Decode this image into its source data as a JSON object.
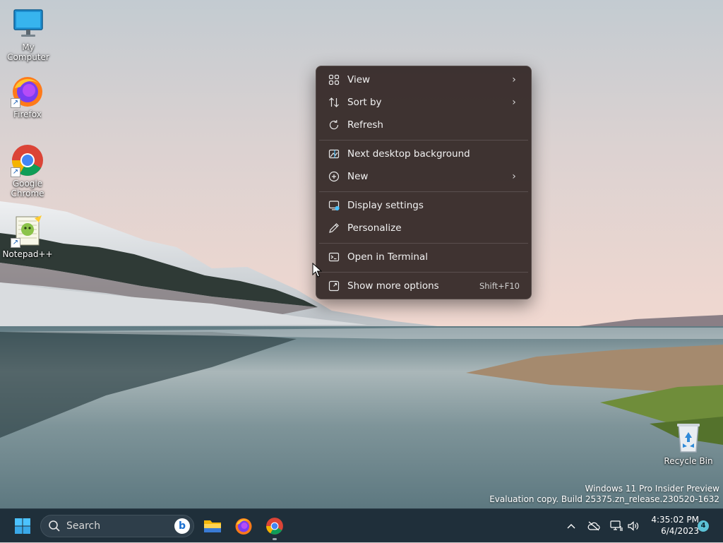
{
  "desktop": {
    "icons": [
      {
        "label": "My Computer",
        "icon": "monitor-icon"
      },
      {
        "label": "Firefox",
        "icon": "firefox-icon"
      },
      {
        "label": "Google Chrome",
        "icon": "chrome-icon"
      },
      {
        "label": "Notepad++",
        "icon": "notepad-plus-plus-icon"
      },
      {
        "label": "Recycle Bin",
        "icon": "recycle-bin-icon"
      }
    ],
    "shortcut_arrow": "↗"
  },
  "context_menu": {
    "items": [
      {
        "label": "View",
        "icon": "grid-icon",
        "submenu": true
      },
      {
        "label": "Sort by",
        "icon": "sort-icon",
        "submenu": true
      },
      {
        "label": "Refresh",
        "icon": "refresh-icon",
        "submenu": false
      },
      {
        "label": "Next desktop background",
        "icon": "next-background-icon",
        "submenu": false
      },
      {
        "label": "New",
        "icon": "plus-circle-icon",
        "submenu": true
      },
      {
        "label": "Display settings",
        "icon": "display-icon",
        "submenu": false
      },
      {
        "label": "Personalize",
        "icon": "pen-icon",
        "submenu": false
      },
      {
        "label": "Open in Terminal",
        "icon": "terminal-icon",
        "submenu": false
      },
      {
        "label": "Show more options",
        "icon": "more-options-icon",
        "shortcut": "Shift+F10"
      }
    ],
    "chevron": "›"
  },
  "watermark": {
    "line1": "Windows 11 Pro Insider Preview",
    "line2": "Evaluation copy. Build 25375.zn_release.230520-1632"
  },
  "taskbar": {
    "search_label": "Search",
    "bing_label": "b",
    "clock_time": "4:35:02 PM",
    "clock_date": "6/4/2023",
    "notification_count": "4",
    "colors": {
      "background": "#1f2f3a",
      "accent": "#4cc2ff"
    }
  }
}
